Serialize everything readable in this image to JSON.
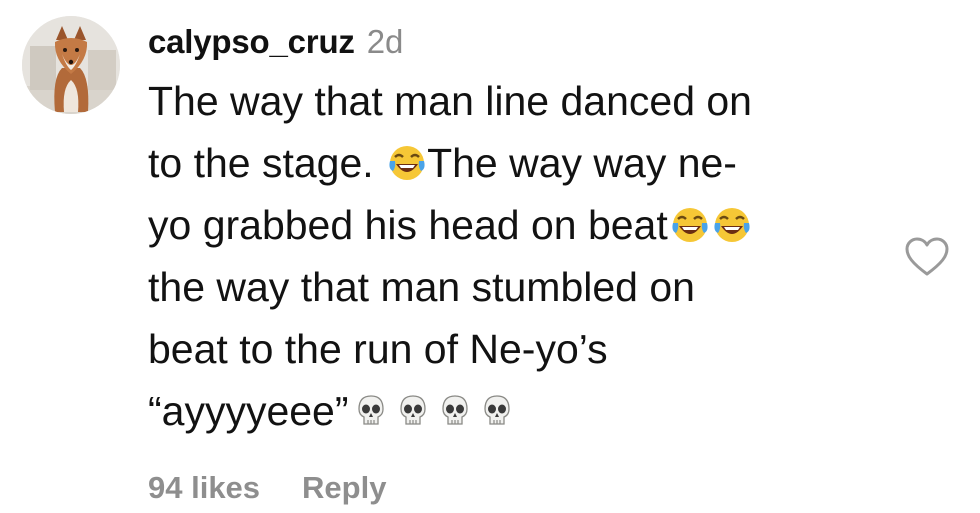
{
  "comment": {
    "username": "calypso_cruz",
    "timestamp": "2d",
    "text_lines": [
      "The way that man line danced on",
      "to the stage. ",
      "The way way ne-",
      "yo grabbed his head on beat",
      "the way that man stumbled on",
      "beat to the run of Ne-yo’s",
      "“ayyyyeee”"
    ],
    "emoji": {
      "laugh": "face-with-tears-of-joy",
      "skull": "skull"
    },
    "likes_label": "94 likes",
    "reply_label": "Reply",
    "like_icon": "heart-outline-icon"
  }
}
